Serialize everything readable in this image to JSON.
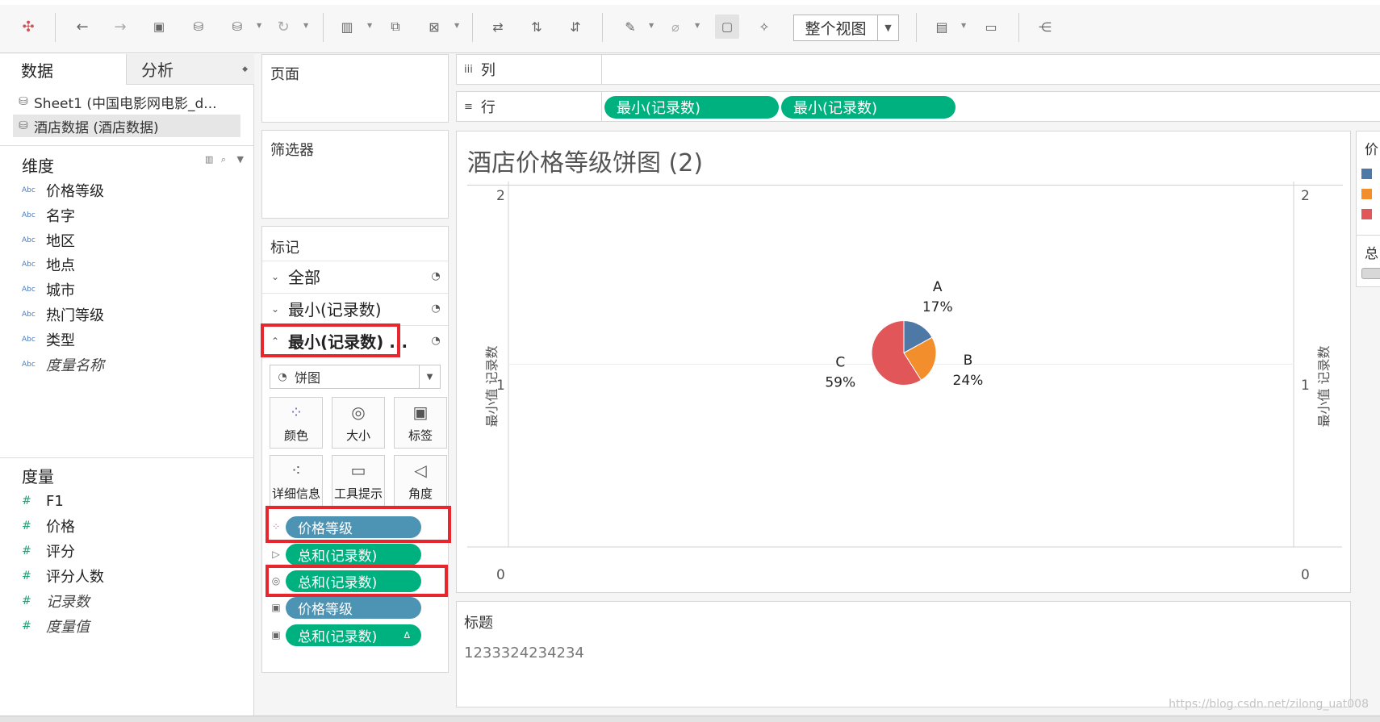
{
  "toolbar": {
    "view_mode": "整个视图"
  },
  "data_pane": {
    "tabs": [
      "数据",
      "分析"
    ],
    "sources": [
      "Sheet1 (中国电影网电影_d...",
      "酒店数据 (酒店数据)"
    ],
    "dimensions_title": "维度",
    "dimensions": [
      "价格等级",
      "名字",
      "地区",
      "地点",
      "城市",
      "热门等级",
      "类型",
      "度量名称"
    ],
    "type_abc": "Abc",
    "measures_title": "度量",
    "measures": [
      "F1",
      "价格",
      "评分",
      "评分人数",
      "记录数",
      "度量值"
    ],
    "measure_icon": "#"
  },
  "cards": {
    "pages": "页面",
    "filters": "筛选器",
    "marks": "标记",
    "marks_rows": [
      "全部",
      "最小(记录数)",
      "最小(记录数) ..."
    ],
    "mark_type": "饼图",
    "mark_buttons": [
      "颜色",
      "大小",
      "标签",
      "详细信息",
      "工具提示",
      "角度"
    ],
    "mark_pills": [
      {
        "label": "价格等级",
        "color": "#4d93b3",
        "icon": "color-icon"
      },
      {
        "label": "总和(记录数)",
        "color": "#00b180",
        "icon": "angle-icon"
      },
      {
        "label": "总和(记录数)",
        "color": "#00b180",
        "icon": "size-icon"
      },
      {
        "label": "价格等级",
        "color": "#4d93b3",
        "icon": "label-icon"
      },
      {
        "label": "总和(记录数)",
        "color": "#00b180",
        "icon": "label-icon",
        "delta": "Δ"
      }
    ]
  },
  "shelves": {
    "columns_label": "列",
    "rows_label": "行",
    "row_pills": [
      "最小(记录数)",
      "最小(记录数)"
    ]
  },
  "viz": {
    "title": "酒店价格等级饼图 (2)",
    "axis_title_left": "最小值 记录数",
    "axis_title_right": "最小值 记录数",
    "y_ticks": [
      "2",
      "1",
      "0"
    ]
  },
  "chart_data": {
    "type": "pie",
    "title": "酒店价格等级饼图 (2)",
    "ylabel": "最小值 记录数",
    "ylim": [
      0,
      2
    ],
    "y_position": 1,
    "slices": [
      {
        "label": "A",
        "value": 17,
        "text": "17%",
        "color": "#4e79a7"
      },
      {
        "label": "B",
        "value": 24,
        "text": "24%",
        "color": "#f28e2b"
      },
      {
        "label": "C",
        "value": 59,
        "text": "59%",
        "color": "#e15759"
      }
    ]
  },
  "legend": {
    "title": "价",
    "colors": [
      "#4e79a7",
      "#f28e2b",
      "#e15759"
    ],
    "title2": "总"
  },
  "caption": {
    "title": "标题",
    "body": "1233324234234"
  },
  "watermark": "https://blog.csdn.net/zilong_uat008"
}
